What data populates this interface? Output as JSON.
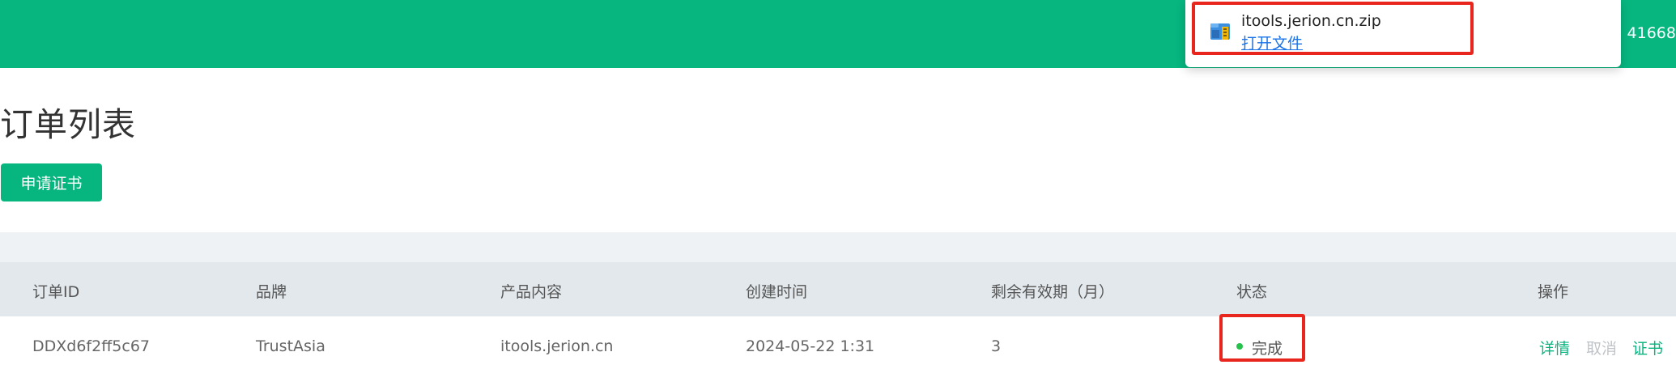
{
  "header": {
    "user_id": "41668"
  },
  "download": {
    "file_name": "itools.jerion.cn.zip",
    "open_label": "打开文件"
  },
  "page": {
    "title": "订单列表",
    "apply_button": "申请证书"
  },
  "table": {
    "columns": [
      "订单ID",
      "品牌",
      "产品内容",
      "创建时间",
      "剩余有效期（月）",
      "状态",
      "操作"
    ],
    "rows": [
      {
        "order_id": "DDXd6f2ff5c67",
        "brand": "TrustAsia",
        "product": "itools.jerion.cn",
        "created": "2024-05-22 1:31",
        "remaining": "3",
        "status": "完成",
        "actions": [
          "详情",
          "取消",
          "证书"
        ]
      }
    ]
  },
  "colors": {
    "brand": "#07b57f",
    "highlight": "#e8261e",
    "status_ok": "#27c24c",
    "action": "#07b57f",
    "action_disabled": "#c0c4c8"
  },
  "icons": {
    "file": "zip-archive-icon"
  }
}
